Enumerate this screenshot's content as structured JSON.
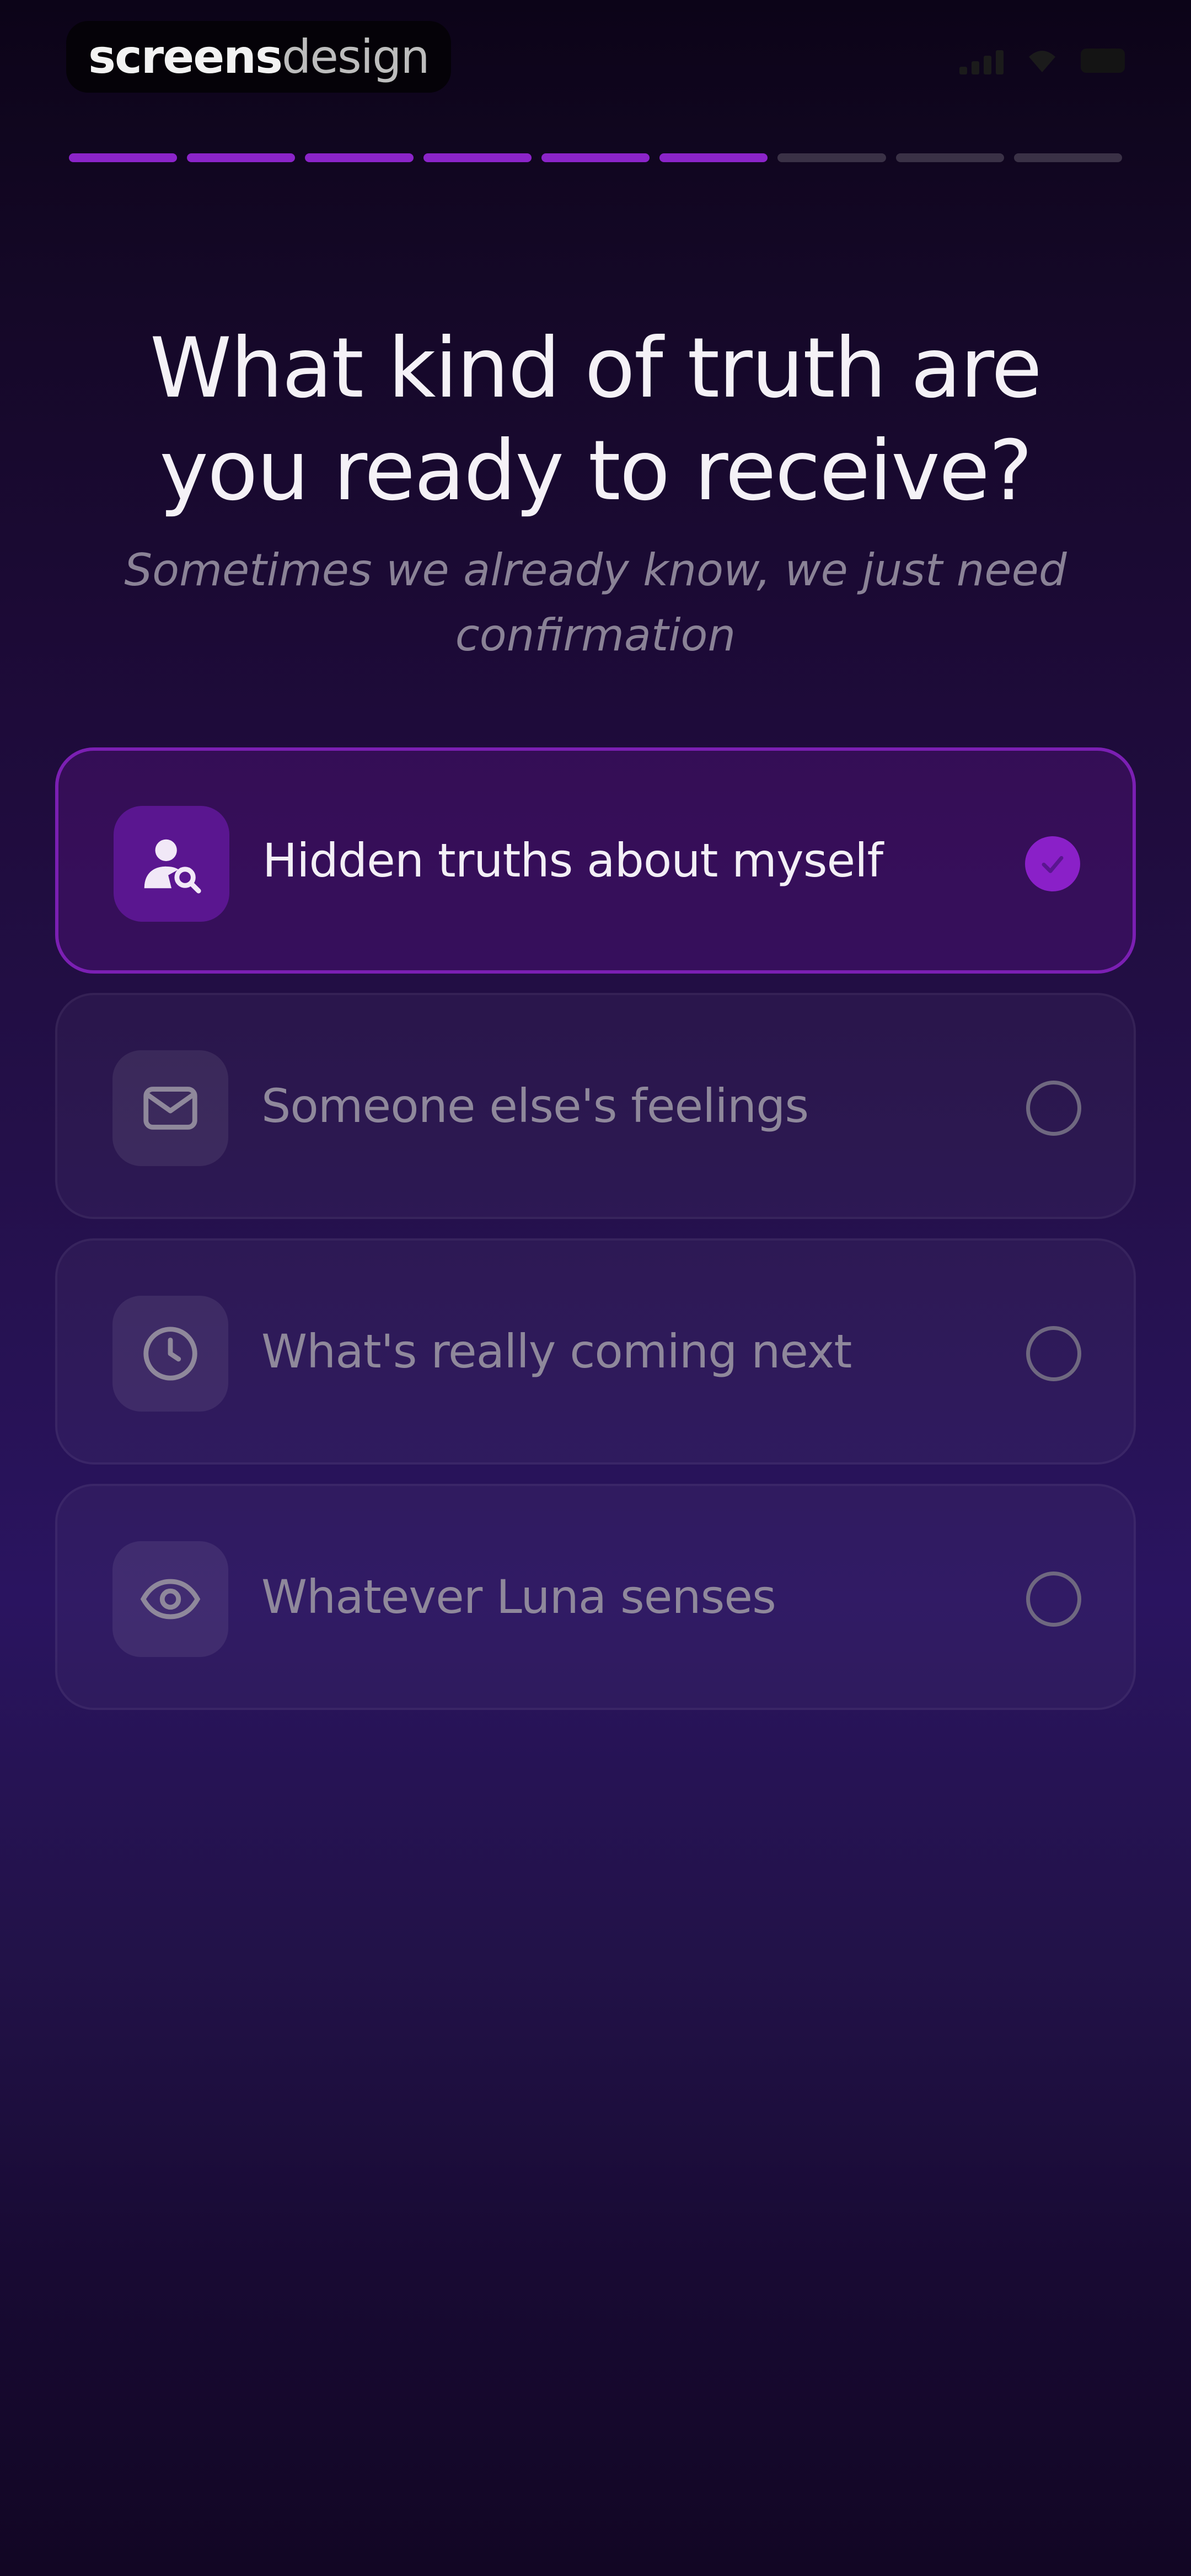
{
  "status_bar": {
    "brand_primary": "screens",
    "brand_secondary": "design"
  },
  "progress": {
    "total_steps": 9,
    "completed_steps": 6,
    "active_color": "#8b24c9",
    "inactive_color": "#3a3146"
  },
  "question": {
    "title": "What kind of truth are you ready to receive?",
    "subtitle": "Sometimes we already know, we just need confirmation"
  },
  "options": [
    {
      "label": "Hidden truths about myself",
      "icon": "person-search-icon",
      "selected": true
    },
    {
      "label": "Someone else's feelings",
      "icon": "envelope-icon",
      "selected": false
    },
    {
      "label": "What's really coming next",
      "icon": "clock-icon",
      "selected": false
    },
    {
      "label": "Whatever Luna senses",
      "icon": "eye-icon",
      "selected": false
    }
  ],
  "colors": {
    "accent": "#8a20c8",
    "selected_border": "#7b1fb3",
    "background_top": "#0c0418",
    "background_mid": "#2a1460"
  }
}
